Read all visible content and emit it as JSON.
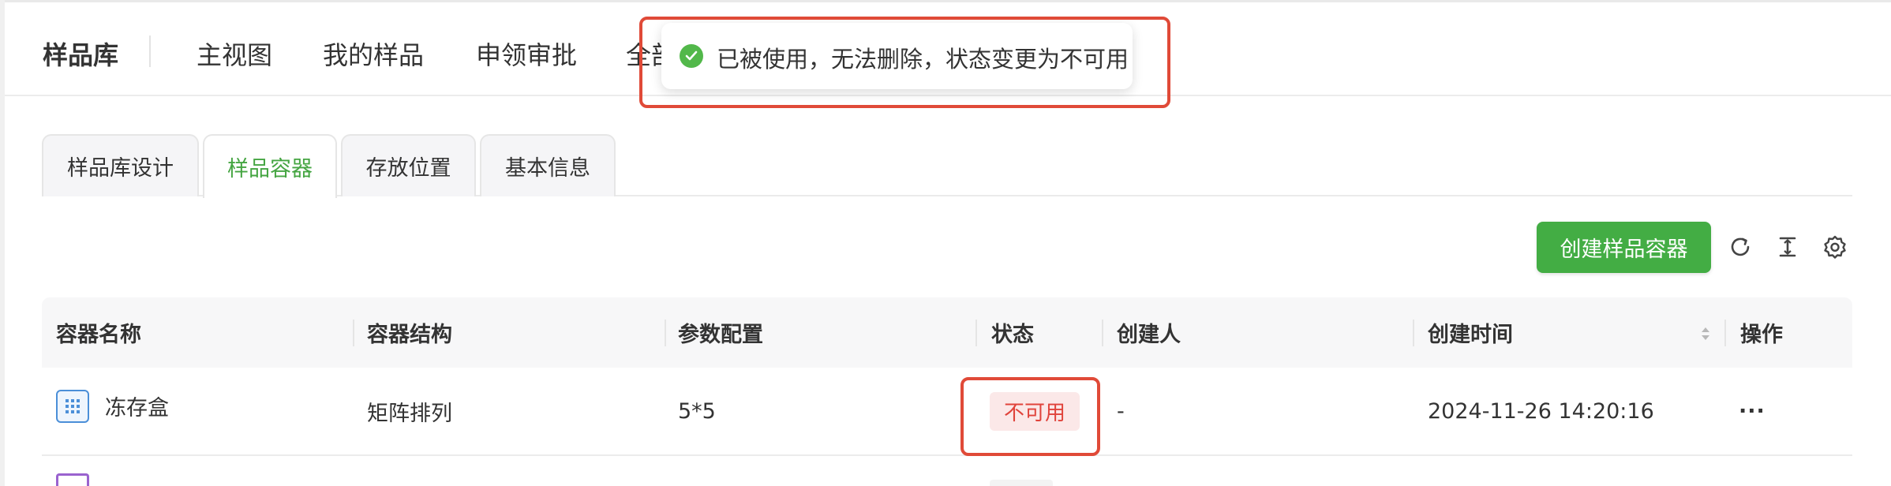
{
  "header": {
    "brand": "样品库",
    "nav": [
      "主视图",
      "我的样品",
      "申领审批",
      "全部"
    ]
  },
  "toast": {
    "message": "已被使用，无法删除，状态变更为不可用",
    "type": "success",
    "icon": "check-circle-icon"
  },
  "tabs": [
    {
      "label": "样品库设计",
      "active": false
    },
    {
      "label": "样品容器",
      "active": true
    },
    {
      "label": "存放位置",
      "active": false
    },
    {
      "label": "基本信息",
      "active": false
    }
  ],
  "toolbar": {
    "create_label": "创建样品容器",
    "icons": [
      "refresh-icon",
      "column-height-icon",
      "settings-icon"
    ]
  },
  "table": {
    "columns": [
      "容器名称",
      "容器结构",
      "参数配置",
      "状态",
      "创建人",
      "创建时间",
      "操作"
    ],
    "rows": [
      {
        "name": "冻存盒",
        "structure": "矩阵排列",
        "params": "5*5",
        "status": "不可用",
        "creator": "-",
        "created_at": "2024-11-26 14:20:16",
        "action": "···"
      }
    ]
  },
  "colors": {
    "primary_green": "#43ad44",
    "status_red": "#e0433b",
    "status_red_bg": "#fbe8e8",
    "highlight_red": "#e04a38"
  }
}
